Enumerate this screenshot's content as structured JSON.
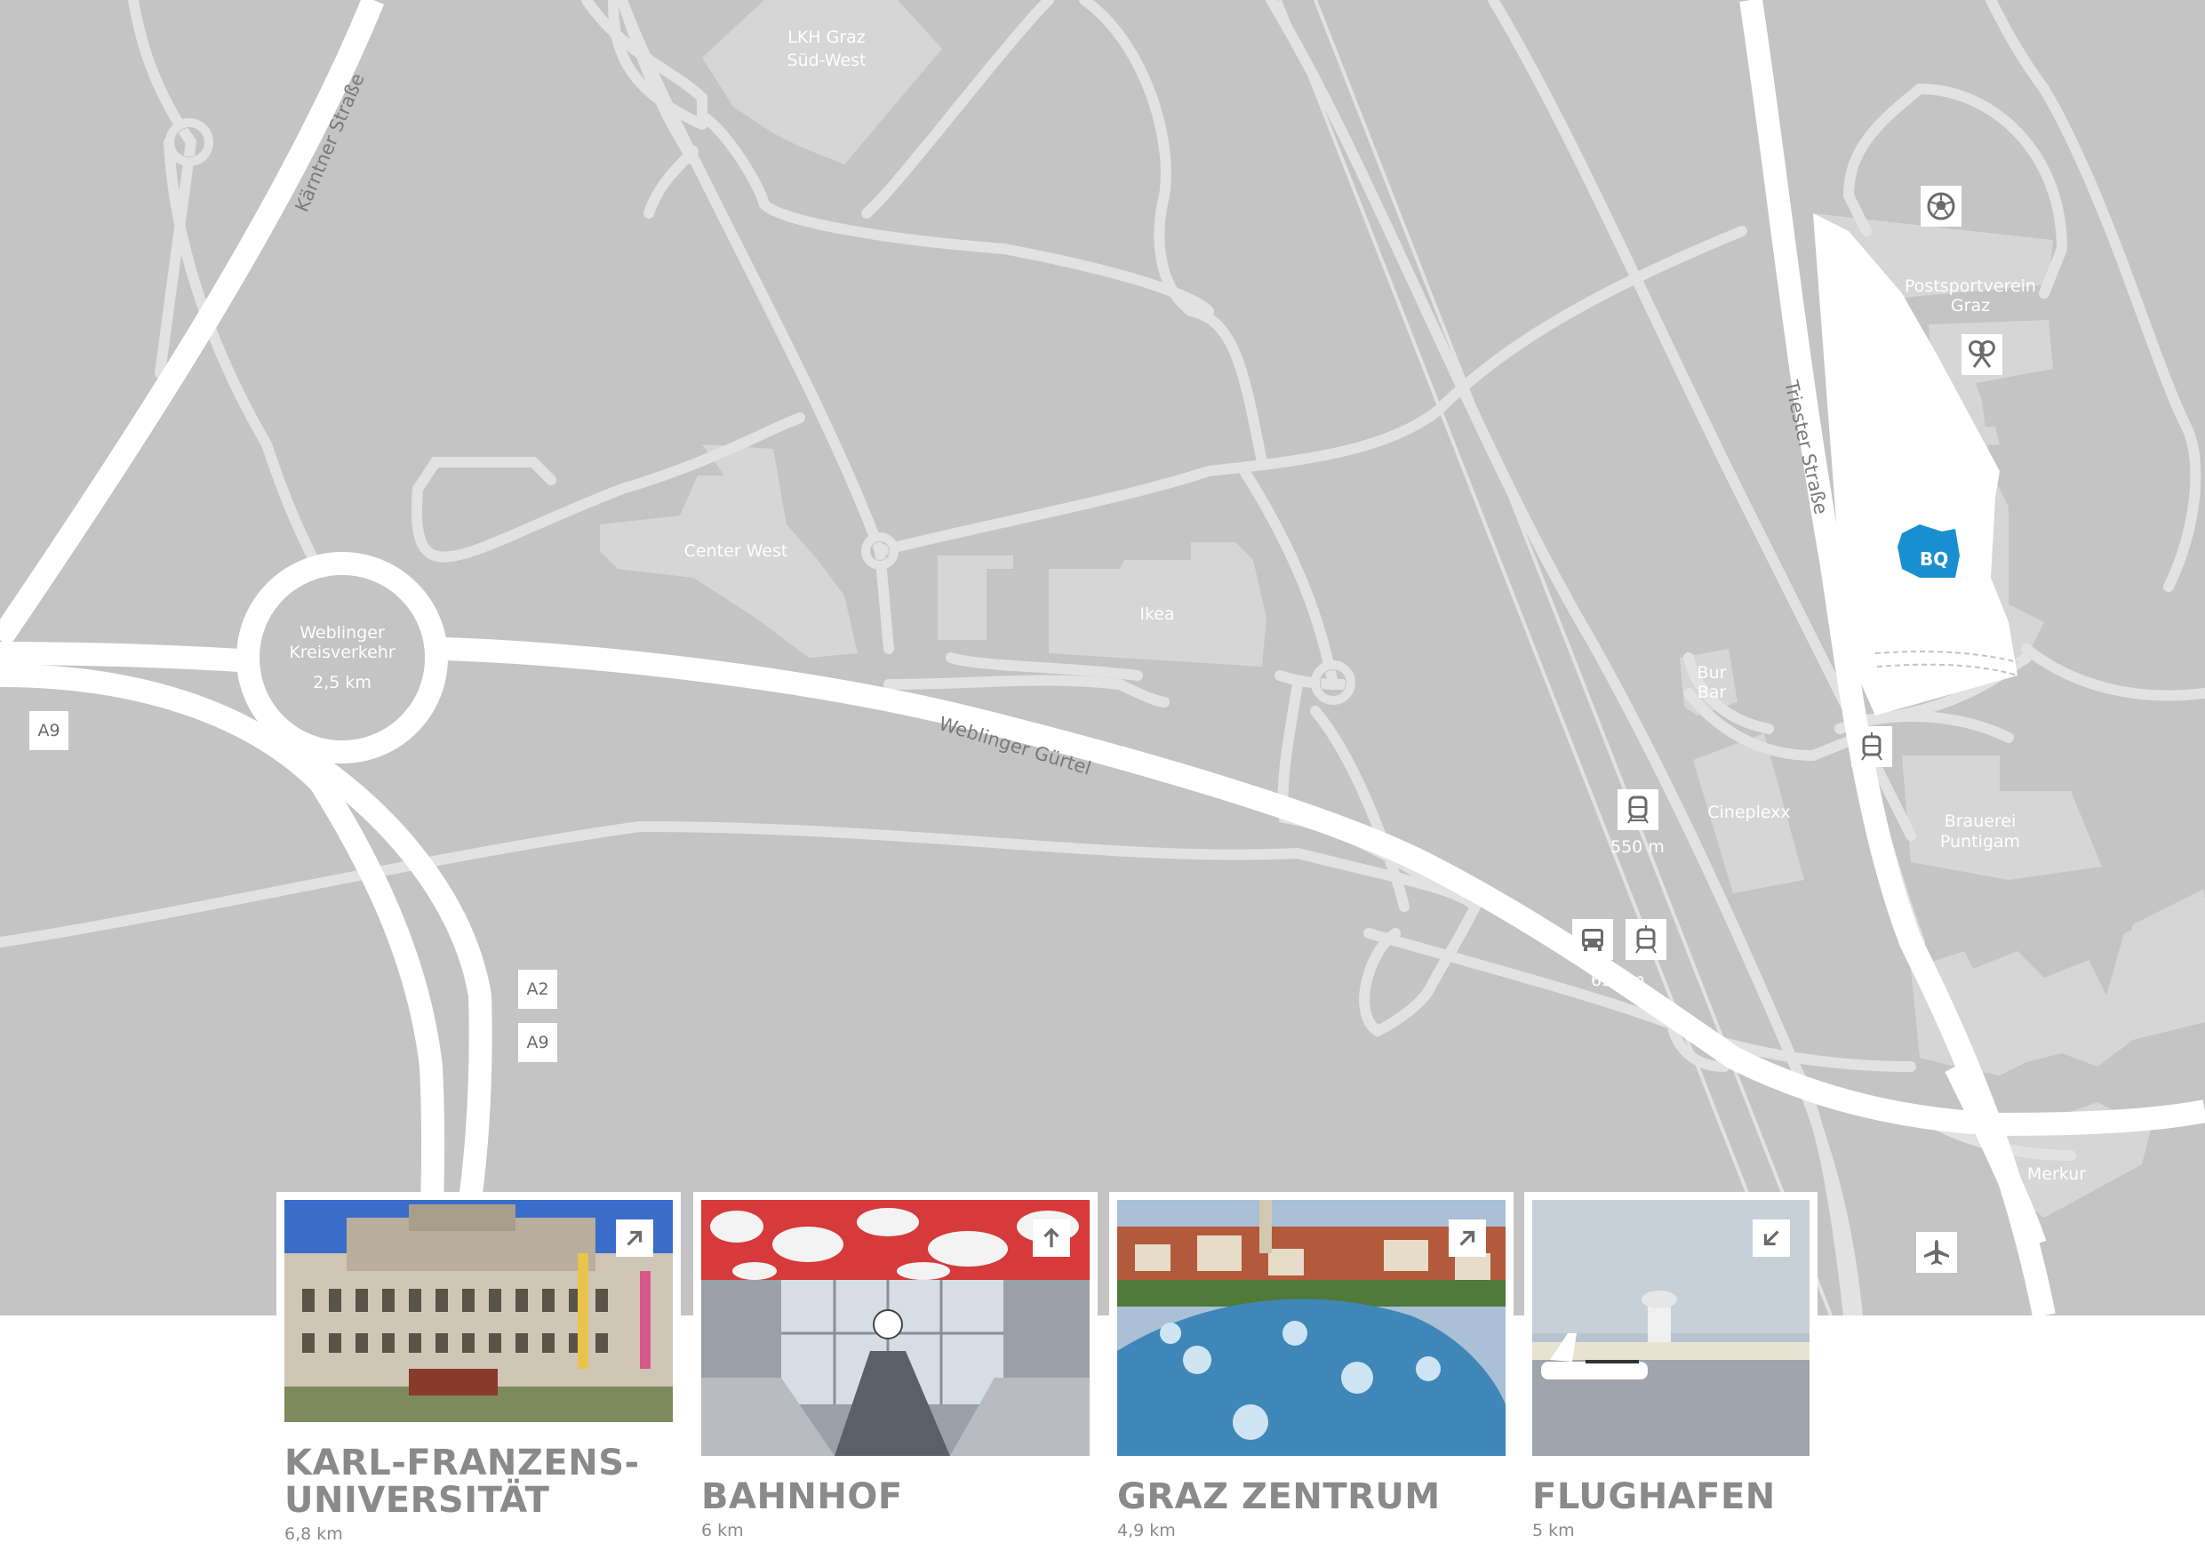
{
  "map": {
    "roads": {
      "kaerntner": "Kärntner Straße",
      "weblinger_guertel": "Weblinger Gürtel",
      "triester": "Triester Straße"
    },
    "places": {
      "lkh_line1": "LKH Graz",
      "lkh_line2": "Süd-West",
      "center_west": "Center West",
      "ikea": "Ikea",
      "kreisverkehr_line1": "Weblinger",
      "kreisverkehr_line2": "Kreisverkehr",
      "kreisverkehr_dist": "2,5 km",
      "postsportverein_line1": "Postsportverein",
      "postsportverein_line2": "Graz",
      "bur_line1": "Bur",
      "bur_line2": "Bar",
      "cineplexx": "Cineplexx",
      "brauerei_line1": "Brauerei",
      "brauerei_line2": "Puntigam",
      "merkur": "Merkur",
      "bq": "BQ"
    },
    "shields": {
      "a9_left": "A9",
      "a2": "A2",
      "a9_bottom": "A9"
    },
    "distances": {
      "train": "550 m",
      "bus_tram": "650 m"
    },
    "icons": {
      "soccer": "soccer-ball-icon",
      "tennis": "tennis-rackets-icon",
      "train": "train-icon",
      "bus": "bus-icon",
      "tram": "tram-icon",
      "airplane": "airplane-icon"
    },
    "colors": {
      "background": "#c4c4c4",
      "roads": "#ffffff",
      "buildings": "#d6d6d6",
      "bq_marker": "#1a8fd0"
    }
  },
  "destinations": [
    {
      "title_line1": "KARL-FRANZENS-",
      "title_line2": "UNIVERSITÄT",
      "distance": "6,8 km",
      "arrow": "arrow-up-right-icon"
    },
    {
      "title_line1": "BAHNHOF",
      "distance": "6 km",
      "arrow": "arrow-up-icon"
    },
    {
      "title_line1": "GRAZ ZENTRUM",
      "distance": "4,9 km",
      "arrow": "arrow-up-right-icon"
    },
    {
      "title_line1": "FLUGHAFEN",
      "distance": "5 km",
      "arrow": "arrow-down-left-icon"
    }
  ]
}
